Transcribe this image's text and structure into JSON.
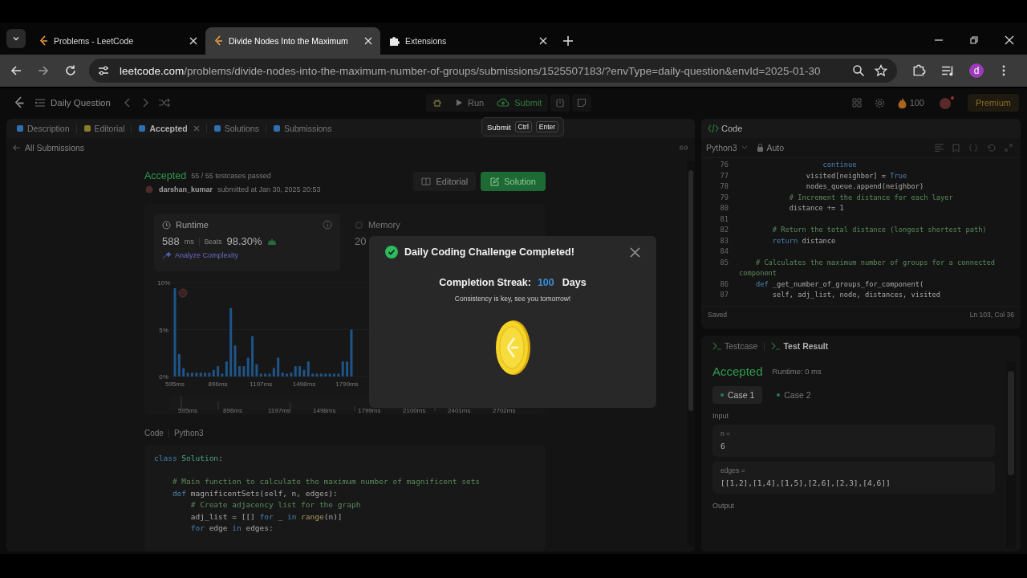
{
  "browser": {
    "tabs": [
      {
        "title": "Problems - LeetCode",
        "selected": false
      },
      {
        "title": "Divide Nodes Into the Maximum",
        "selected": true
      },
      {
        "title": "Extensions",
        "selected": false
      }
    ],
    "url": {
      "host": "leetcode.com",
      "path": "/problems/divide-nodes-into-the-maximum-number-of-groups/submissions/1525507183/?envType=daily-question&envId=2025-01-30"
    },
    "profile": "d"
  },
  "toolbar": {
    "problem_list": "Daily Question",
    "run": "Run",
    "submit": "Submit",
    "streak": "100",
    "premium": "Premium"
  },
  "tooltip": {
    "label": "Submit",
    "keys": [
      "Ctrl",
      "Enter"
    ]
  },
  "left_panel": {
    "tabs": [
      {
        "label": "Description",
        "selected": false
      },
      {
        "label": "Editorial",
        "selected": false
      },
      {
        "label": "Accepted",
        "selected": true
      },
      {
        "label": "Solutions",
        "selected": false
      },
      {
        "label": "Submissions",
        "selected": false
      }
    ],
    "back_link": "All Submissions",
    "submission": {
      "status": "Accepted",
      "passed": "55 / 55 testcases passed",
      "author": "darshan_kumar",
      "submitted": "submitted at Jan 30, 2025 20:53",
      "editorial_button": "Editorial",
      "solution_button": "Solution"
    },
    "runtime": {
      "title": "Runtime",
      "value": "588",
      "unit": "ms",
      "beats_label": "Beats",
      "beats": "98.30%",
      "analyze": "Analyze Complexity"
    },
    "memory": {
      "title": "Memory",
      "value": "20"
    },
    "chart_data": {
      "type": "bar",
      "ylim": [
        0,
        10
      ],
      "xlim": [
        580,
        1845
      ],
      "x": [
        595,
        625,
        655,
        685,
        715,
        746,
        776,
        806,
        836,
        866,
        896,
        926,
        956,
        986,
        1016,
        1047,
        1077,
        1107,
        1137,
        1167,
        1197,
        1227,
        1257,
        1287,
        1317,
        1348,
        1378,
        1408,
        1438,
        1468,
        1498,
        1528,
        1558,
        1588,
        1618,
        1649,
        1679,
        1709,
        1739,
        1769,
        1799,
        1829
      ],
      "yticks": [
        {
          "value": 0,
          "label": "0%"
        },
        {
          "value": 5,
          "label": "5%"
        },
        {
          "value": 10,
          "label": "10%"
        }
      ],
      "xticks": [
        {
          "value": 595,
          "label": "595ms"
        },
        {
          "value": 896,
          "label": "896ms"
        },
        {
          "value": 1197,
          "label": "1197ms"
        },
        {
          "value": 1498,
          "label": "1498ms"
        },
        {
          "value": 1799,
          "label": "1799ms"
        }
      ],
      "values": [
        9.4,
        2.4,
        0.9,
        0.4,
        0.4,
        0.4,
        0.4,
        0.4,
        0.4,
        0.7,
        1.1,
        0.3,
        1.6,
        7.3,
        3.3,
        1.1,
        1.1,
        2.0,
        4.3,
        1.3,
        0.3,
        0.3,
        0.3,
        0.9,
        2.0,
        0.4,
        0.3,
        0.4,
        1.1,
        1.1,
        0.7,
        1.6,
        0.3,
        0.3,
        0.3,
        0.3,
        0.3,
        0.3,
        0.3,
        1.6,
        1.6,
        5.0
      ]
    },
    "range_labels": [
      "595ms",
      "896ms",
      "1197ms",
      "1498ms",
      "1799ms",
      "2100ms",
      "2401ms",
      "2702ms"
    ],
    "code": {
      "label": "Code",
      "language": "Python3",
      "lines": [
        {
          "tokens": [
            {
              "kind": "kw",
              "text": "class "
            },
            {
              "kind": "cls",
              "text": "Solution"
            },
            {
              "kind": "plain",
              "text": ":"
            }
          ]
        },
        {
          "space_before": true,
          "tokens": [
            {
              "kind": "cmt",
              "text": "    # Main function to calculate the maximum number of magnificent sets"
            }
          ]
        },
        {
          "tokens": [
            {
              "kind": "kw",
              "text": "    def "
            },
            {
              "kind": "plain",
              "text": "magnificentSets(self, n, edges):"
            }
          ]
        },
        {
          "tokens": [
            {
              "kind": "cmt",
              "text": "        # Create adjacency list for the graph"
            }
          ]
        },
        {
          "tokens": [
            {
              "kind": "plain",
              "text": "        adj_list = [[] "
            },
            {
              "kind": "kw",
              "text": "for"
            },
            {
              "kind": "plain",
              "text": " _ "
            },
            {
              "kind": "kw",
              "text": "in"
            },
            {
              "kind": "fn",
              "text": " range"
            },
            {
              "kind": "plain",
              "text": "(n)]"
            }
          ]
        },
        {
          "tokens": [
            {
              "kind": "kw",
              "text": "        for"
            },
            {
              "kind": "plain",
              "text": " edge "
            },
            {
              "kind": "kw",
              "text": "in"
            },
            {
              "kind": "plain",
              "text": " edges:"
            }
          ]
        }
      ]
    }
  },
  "code_panel": {
    "title": "Code",
    "language": "Python3",
    "mode": "Auto",
    "status": "Saved",
    "cursor": "Ln 103, Col 36",
    "lines": [
      {
        "number": "76",
        "tokens": [
          {
            "kind": "kw",
            "text": "                    continue"
          }
        ]
      },
      {
        "number": "77",
        "tokens": [
          {
            "kind": "plain",
            "text": "                visited[neighbor] = "
          },
          {
            "kind": "kw",
            "text": "True"
          }
        ]
      },
      {
        "number": "78",
        "tokens": [
          {
            "kind": "plain",
            "text": "                nodes_queue.append(neighbor)"
          }
        ]
      },
      {
        "number": "79",
        "tokens": [
          {
            "kind": "cmt",
            "text": "            # Increment the distance for each layer"
          }
        ]
      },
      {
        "number": "80",
        "tokens": [
          {
            "kind": "plain",
            "text": "            distance += 1"
          }
        ]
      },
      {
        "number": "81"
      },
      {
        "number": "82",
        "tokens": [
          {
            "kind": "cmt",
            "text": "        # Return the total distance (longest shortest path)"
          }
        ]
      },
      {
        "number": "83",
        "tokens": [
          {
            "kind": "kw",
            "text": "        return"
          },
          {
            "kind": "plain",
            "text": " distance"
          }
        ]
      },
      {
        "number": "84"
      },
      {
        "number": "85",
        "tokens": [
          {
            "kind": "cmt",
            "text": "    # Calculates the maximum number of groups for a connected component"
          }
        ]
      },
      {
        "number": "86",
        "tokens": [
          {
            "kind": "kw",
            "text": "    def"
          },
          {
            "kind": "plain",
            "text": " _get_number_of_groups_for_component("
          }
        ]
      },
      {
        "number": "87",
        "tokens": [
          {
            "kind": "plain",
            "text": "        self, adj_list, node, distances, visited"
          }
        ]
      }
    ]
  },
  "test_panel": {
    "tabs": [
      {
        "label": "Testcase",
        "selected": false
      },
      {
        "label": "Test Result",
        "selected": true
      }
    ],
    "status": "Accepted",
    "runtime": "Runtime: 0 ms",
    "cases": [
      {
        "label": "Case 1",
        "selected": true
      },
      {
        "label": "Case 2",
        "selected": false
      }
    ],
    "input_label": "Input",
    "inputs": [
      {
        "name": "n =",
        "value": "6"
      },
      {
        "name": "edges =",
        "value": "[[1,2],[1,4],[1,5],[2,6],[2,3],[4,6]]"
      }
    ],
    "output_label": "Output"
  },
  "modal": {
    "title": "Daily Coding Challenge Completed!",
    "streak_label": "Completion Streak:",
    "streak_value": "100",
    "streak_unit": "Days",
    "message": "Consistency is key, see you tomorrow!"
  }
}
